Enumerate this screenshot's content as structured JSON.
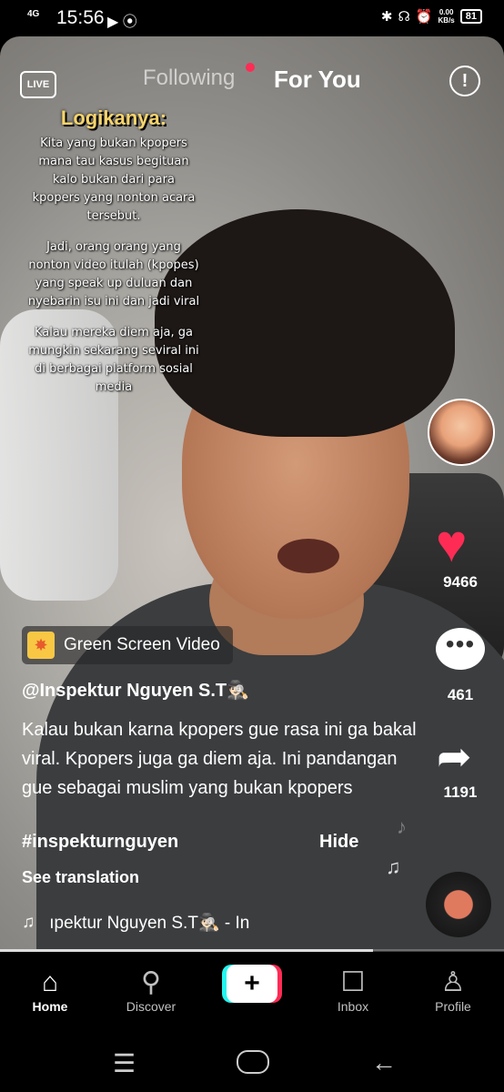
{
  "status_bar": {
    "network": "4G",
    "time": "15:56",
    "speed_top": "0.00",
    "speed_bottom": "KB/s",
    "battery": "81"
  },
  "top_nav": {
    "following": "Following",
    "for_you": "For You"
  },
  "overlay": {
    "heading": "Logikanya:",
    "para1": "Kita yang bukan kpopers mana tau kasus begituan kalo bukan dari para kpopers yang nonton acara tersebut.",
    "para2": "Jadi, orang orang yang nonton video itulah (kpopes) yang speak up duluan dan nyebarin isu ini dan jadi viral",
    "para3": "Kalau mereka diem aja, ga mungkin sekarang seviral ini di berbagai platform sosial media"
  },
  "actions": {
    "likes": "9466",
    "comments": "461",
    "shares": "1191"
  },
  "post": {
    "effect_badge": "Green Screen Video",
    "username": "@Inspektur Nguyen S.T🕵🏻",
    "caption": "Kalau bukan karna kpopers gue rasa ini ga bakal viral. Kpopers juga ga diem aja. Ini pandangan gue sebagai muslim yang bukan kpopers",
    "hashtag": "#inspekturnguyen",
    "hide": "Hide",
    "see_translation": "See translation",
    "sound": "ıpektur Nguyen S.T🕵🏻 - In"
  },
  "progress": 0.74,
  "bottom_nav": {
    "home": "Home",
    "discover": "Discover",
    "inbox": "Inbox",
    "profile": "Profile"
  },
  "icons": {
    "live": "live-tv-icon",
    "alert": "exclamation-icon",
    "like": "heart-icon",
    "comment": "comment-bubble-icon",
    "share": "share-arrow-icon",
    "music": "music-note-icon"
  },
  "colors": {
    "accent_red": "#fe2c55",
    "accent_cyan": "#25f4ee",
    "heading_yellow": "#f6d46b"
  }
}
